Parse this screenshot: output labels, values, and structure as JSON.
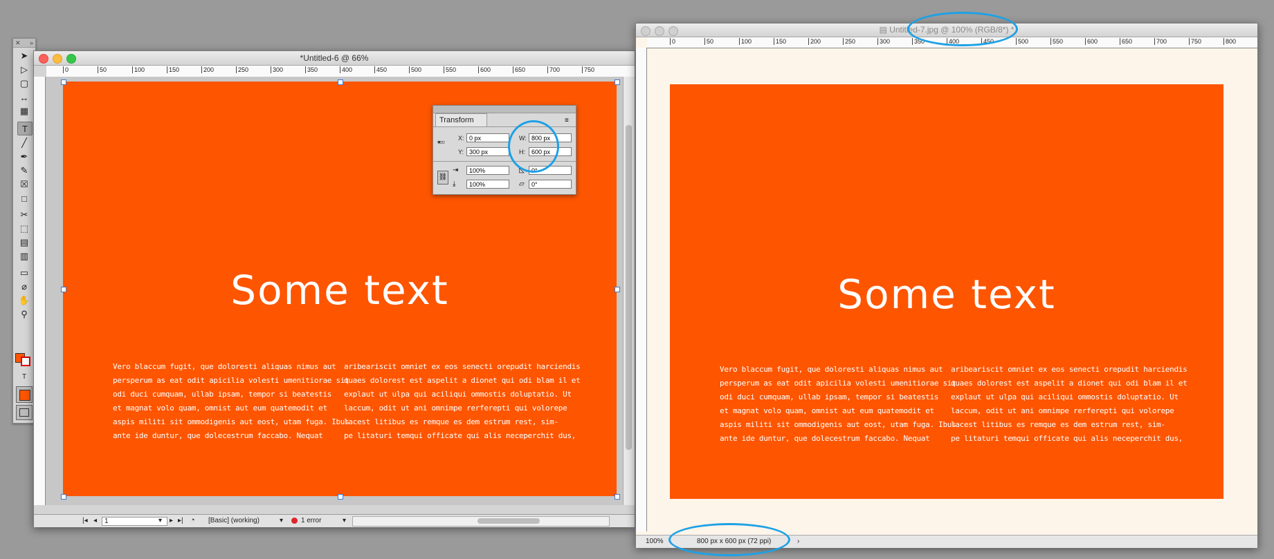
{
  "tools": {
    "items": [
      "selection-tool",
      "direct-selection-tool",
      "page-tool",
      "gap-tool",
      "content-collector-tool",
      "type-tool",
      "line-tool",
      "pen-tool",
      "pencil-tool",
      "rectangle-frame-tool",
      "rectangle-tool",
      "scissors-tool",
      "free-transform-tool",
      "gradient-tool",
      "gradient-feather-tool",
      "note-tool",
      "eyedropper-tool",
      "hand-tool",
      "zoom-tool"
    ]
  },
  "indesign": {
    "title": "*Untitled-6 @ 66%",
    "ruler_ticks": [
      "0",
      "50",
      "100",
      "150",
      "200",
      "250",
      "300",
      "350",
      "400",
      "450",
      "500",
      "550",
      "600",
      "650",
      "700",
      "750"
    ],
    "headline": "Some text",
    "col1": "Vero blaccum fugit, que doloresti aliquas nimus aut\npersperum as eat odit apicilia volesti umenitiorae sit\nodi duci cumquam, ullab ipsam, tempor si beatestis\net magnat volo quam, omnist aut eum quatemodit et\naspis militi sit ommodigenis aut eost, utam fuga. Ibus\nante ide duntur, que dolecestrum faccabo. Nequat",
    "col2": "aribeariscit omniet ex eos senecti orepudit harciendis\nquaes dolorest est aspelit a dionet qui odi blam il et\nexplaut ut ulpa qui aciliqui ommostis doluptatio. Ut\nlaccum, odit ut ani omnimpe rerferepti qui volorepe\nlacest litibus es remque es dem estrum rest, sim-\npe litaturi temqui officate qui alis neceperchit dus,",
    "status": {
      "page": "1",
      "preflight_profile": "[Basic] (working)",
      "errors": "1 error"
    }
  },
  "transform": {
    "tab": "Transform",
    "x_label": "X:",
    "x_value": "0 px",
    "y_label": "Y:",
    "y_value": "300 px",
    "w_label": "W:",
    "w_value": "800 px",
    "h_label": "H:",
    "h_value": "600 px",
    "scale_x": "100%",
    "scale_y": "100%",
    "rotate": "0°",
    "shear": "0°"
  },
  "photoshop": {
    "title": "Untitled-7.jpg @ 100% (RGB/8*) *",
    "ruler_ticks": [
      "0",
      "50",
      "100",
      "150",
      "200",
      "250",
      "300",
      "350",
      "400",
      "450",
      "500",
      "550",
      "600",
      "650",
      "700",
      "750",
      "800"
    ],
    "headline": "Some text",
    "zoom": "100%",
    "doc_info": "800 px x 600 px (72 ppi)"
  },
  "colors": {
    "accent": "#fe5500",
    "highlight": "#1da1e6"
  }
}
